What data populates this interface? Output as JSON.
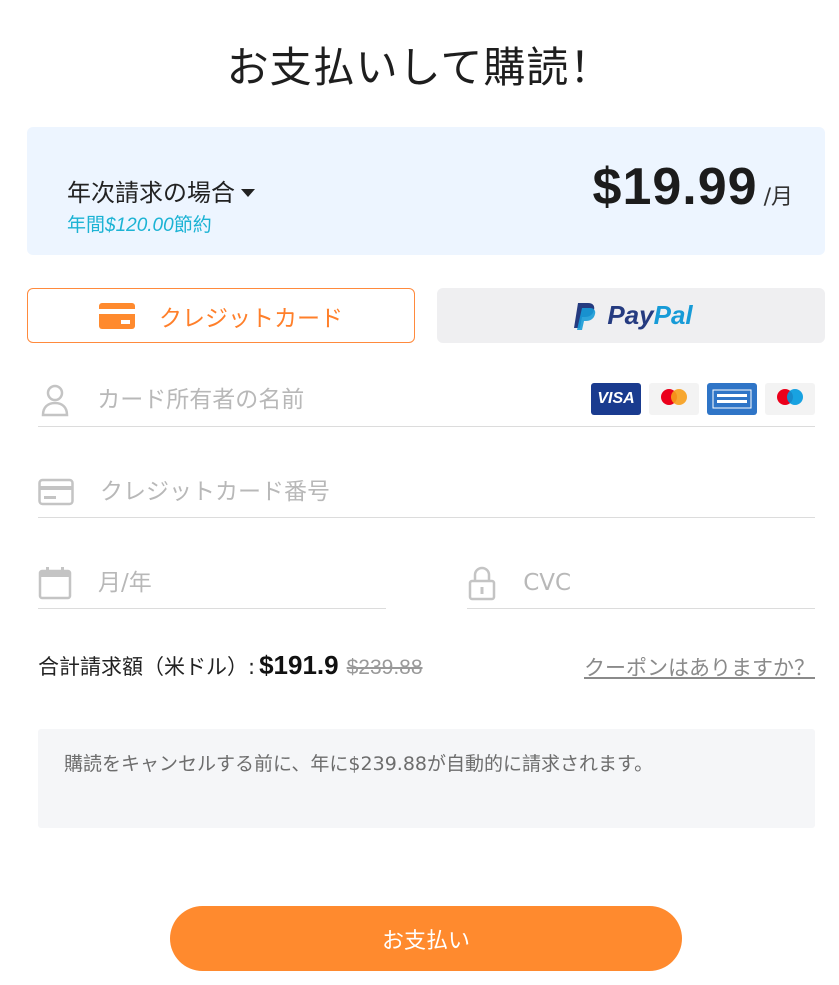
{
  "page": {
    "title": "お支払いして購読！"
  },
  "plan": {
    "label": "年次請求の場合",
    "savings_prefix": "年間",
    "savings_amount": "$120.00",
    "savings_suffix": "節約",
    "price": "$19.99",
    "price_unit": "/月"
  },
  "payment_methods": {
    "card_label": "クレジットカード",
    "paypal_pay": "Pay",
    "paypal_pal": "Pal"
  },
  "card_logos": [
    "VISA",
    "mastercard",
    "AMERICAN EXPRESS",
    "maestro"
  ],
  "form": {
    "name_placeholder": "カード所有者の名前",
    "number_placeholder": "クレジットカード番号",
    "expiry_placeholder": "月/年",
    "cvc_placeholder": "CVC"
  },
  "summary": {
    "total_label": "合計請求額（米ドル）:",
    "total_amount": "$191.9",
    "original_amount": "$239.88",
    "coupon_link": "クーポンはありますか？"
  },
  "notice": {
    "text": "購読をキャンセルする前に、年に$239.88が自動的に請求されます。"
  },
  "actions": {
    "pay_button": "お支払い"
  },
  "colors": {
    "accent": "#ff8a2e",
    "savings": "#1cb3d4",
    "plan_bg": "#edf5ff",
    "paypal_dark": "#253b80",
    "paypal_light": "#179bd7"
  }
}
